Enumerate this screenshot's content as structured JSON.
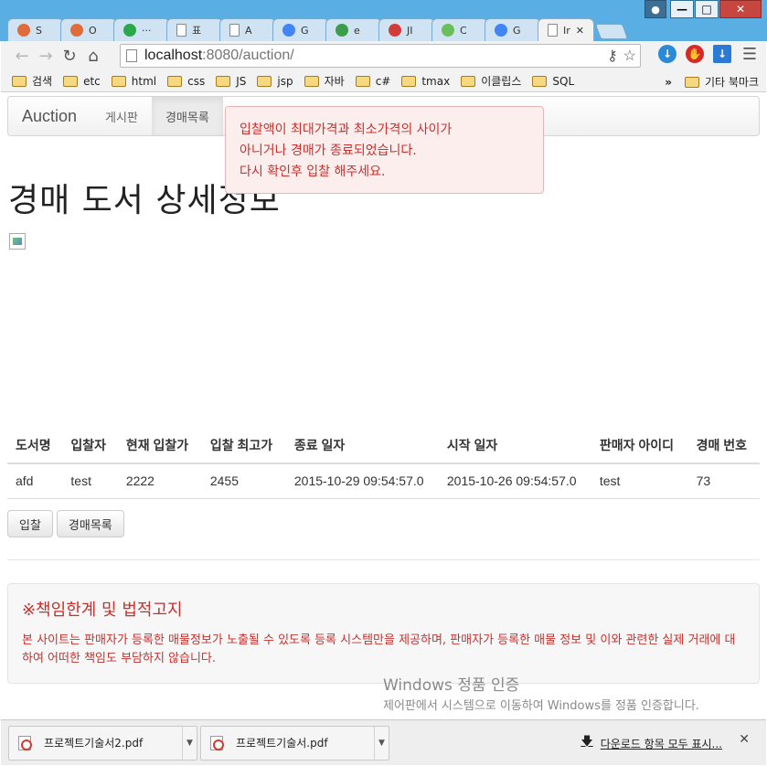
{
  "browser": {
    "tabs": [
      {
        "label": "S",
        "favicon_color": "#e06c3c"
      },
      {
        "label": "O",
        "favicon_color": "#e06c3c"
      },
      {
        "label": "···",
        "favicon_color": "#2aa84a"
      },
      {
        "label": "표",
        "favicon_color": "#ffffff"
      },
      {
        "label": "A",
        "favicon_color": "#ffffff"
      },
      {
        "label": "G",
        "favicon_color": "#4285f4"
      },
      {
        "label": "e",
        "favicon_color": "#3a9e4b"
      },
      {
        "label": "JI",
        "favicon_color": "#d33a3a"
      },
      {
        "label": "C",
        "favicon_color": "#6bbf5a"
      },
      {
        "label": "G",
        "favicon_color": "#4285f4"
      },
      {
        "label": "Ir",
        "favicon_color": "#ffffff",
        "active": true
      }
    ],
    "url_host": "localhost",
    "url_rest": ":8080/auction/",
    "bookmarks": [
      "검색",
      "etc",
      "html",
      "css",
      "JS",
      "jsp",
      "자바",
      "c#",
      "tmax",
      "이클립스",
      "SQL"
    ],
    "bookmarks_more": "»",
    "other_bookmarks": "기타 북마크"
  },
  "navbar": {
    "brand": "Auction",
    "links": [
      "게시판",
      "경매목록"
    ]
  },
  "alert": {
    "lines": [
      "입찰액이 최대가격과 최소가격의 사이가",
      "아니거나 경매가 종료되었습니다.",
      "다시 확인후 입찰 해주세요."
    ]
  },
  "page_title": "경매 도서 상세정보",
  "table": {
    "headers": [
      "도서명",
      "입찰자",
      "현재 입찰가",
      "입찰 최고가",
      "종료 일자",
      "시작 일자",
      "판매자 아이디",
      "경매 번호"
    ],
    "rows": [
      [
        "afd",
        "test",
        "2222",
        "2455",
        "2015-10-29 09:54:57.0",
        "2015-10-26 09:54:57.0",
        "test",
        "73"
      ]
    ]
  },
  "buttons": {
    "bid": "입찰",
    "list": "경매목록"
  },
  "notice": {
    "title": "※책임한계 및 법적고지",
    "text": "본 사이트는 판매자가 등록한 매물정보가 노출될 수 있도록 등록 시스템만을 제공하며, 판매자가 등록한 매물 정보 및 이와 관련한 실제 거래에 대하여 어떠한 책임도 부담하지 않습니다."
  },
  "watermark": {
    "title": "Windows 정품 인증",
    "subtitle": "제어판에서 시스템으로 이동하여 Windows를 정품 인증합니다."
  },
  "downloads": {
    "items": [
      "프로젝트기술서2.pdf",
      "프로젝트기술서.pdf"
    ],
    "show_all": "다운로드 항목 모두 표시...",
    "close": "✕"
  }
}
